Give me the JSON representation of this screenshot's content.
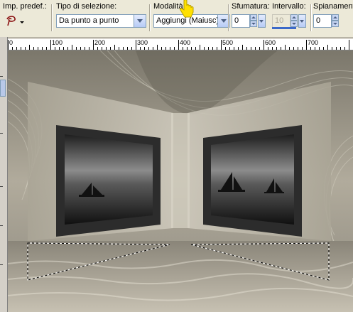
{
  "toolbar": {
    "preset": {
      "label": "Imp. predef.:"
    },
    "selection_type": {
      "label": "Tipo di selezione:",
      "value": "Da punto a punto"
    },
    "mode": {
      "label": "Modalità:",
      "value": "Aggiungi (Maiusc)"
    },
    "feather": {
      "label": "Sfumatura:",
      "value": "0"
    },
    "interval": {
      "label": "Intervallo:",
      "value": "10"
    },
    "smoothing": {
      "label": "Spianamento:",
      "value": "0"
    }
  },
  "ruler": {
    "marks": [
      "0",
      "100",
      "200",
      "300",
      "400",
      "500",
      "600",
      "700"
    ]
  },
  "icons": {
    "tool": "freehand-lasso-icon",
    "cursor": "hand-pointer-cursor-icon"
  },
  "colors": {
    "toolbar": "#ece9d8",
    "accent": "#3c6ac9"
  }
}
